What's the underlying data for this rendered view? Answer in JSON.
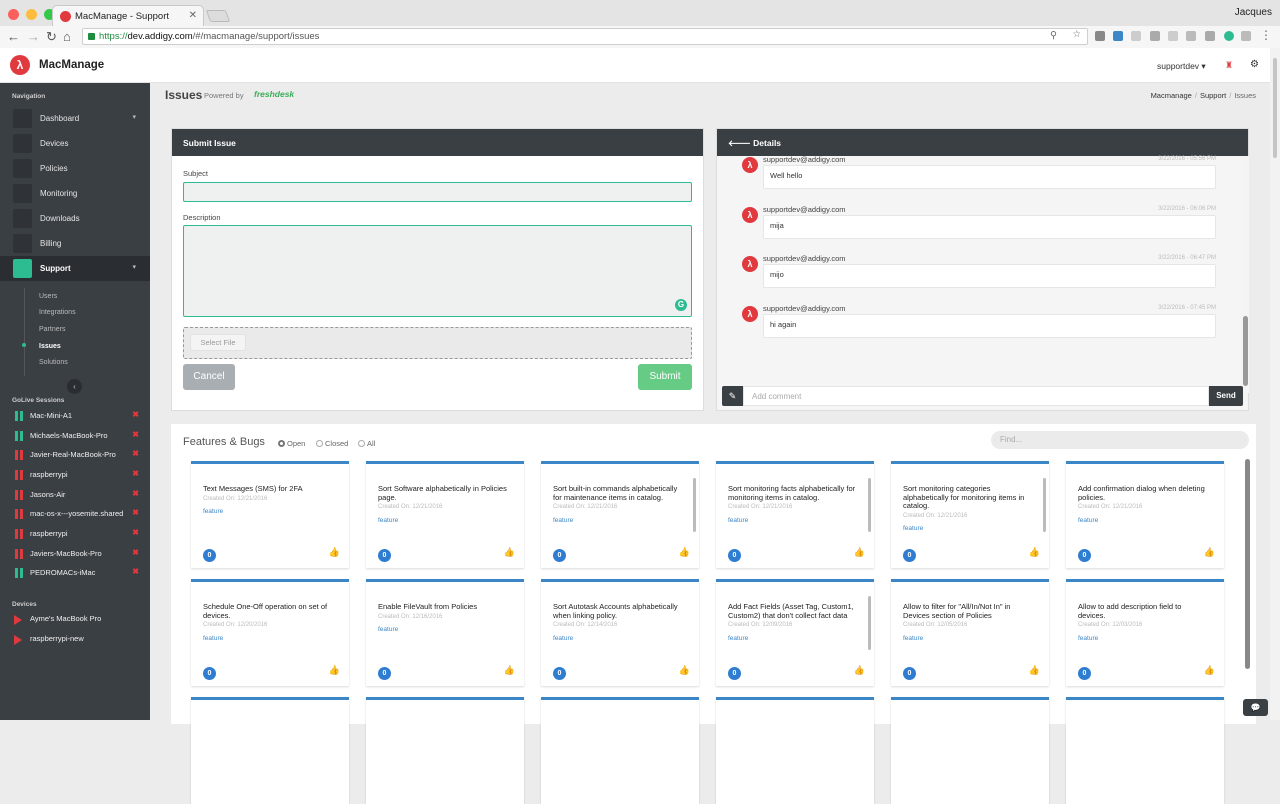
{
  "browser": {
    "tab_title": "MacManage - Support",
    "user": "Jacques",
    "url_scheme": "https://",
    "url_host": "dev.addigy.com",
    "url_path": "/#/macmanage/support/issues"
  },
  "app": {
    "logo_letter": "λ",
    "brand": "MacManage",
    "account": "supportdev ▾"
  },
  "sidebar": {
    "nav_heading": "Navigation",
    "items": [
      {
        "label": "Dashboard",
        "caret": "▾"
      },
      {
        "label": "Devices"
      },
      {
        "label": "Policies"
      },
      {
        "label": "Monitoring"
      },
      {
        "label": "Downloads"
      },
      {
        "label": "Billing"
      },
      {
        "label": "Support",
        "caret": "▾"
      }
    ],
    "sub_items": [
      "Users",
      "Integrations",
      "Partners",
      "Issues",
      "Solutions"
    ],
    "collapse_glyph": "‹",
    "golive_heading": "GoLive Sessions",
    "sessions": [
      {
        "name": "Mac-Mini-A1",
        "status": "online"
      },
      {
        "name": "Michaels-MacBook-Pro",
        "status": "online"
      },
      {
        "name": "Javier-Real-MacBook-Pro",
        "status": "offline"
      },
      {
        "name": "raspberrypi",
        "status": "offline"
      },
      {
        "name": "Jasons-Air",
        "status": "offline"
      },
      {
        "name": "mac-os-x---yosemite.shared",
        "status": "offline"
      },
      {
        "name": "raspberrypi",
        "status": "offline"
      },
      {
        "name": "Javiers-MacBook-Pro",
        "status": "offline"
      },
      {
        "name": "PEDROMACs-iMac",
        "status": "online"
      }
    ],
    "session_close": "✖",
    "devices_heading": "Devices",
    "devices": [
      "Ayme's MacBook Pro",
      "raspberrypi-new"
    ]
  },
  "page": {
    "title": "Issues",
    "powered_by": "Powered by",
    "freshdesk": "freshdesk",
    "breadcrumb": [
      "Macmanage",
      "Support",
      "Issues"
    ]
  },
  "submit": {
    "header": "Submit Issue",
    "subject_label": "Subject",
    "description_label": "Description",
    "select_file": "Select File",
    "cancel": "Cancel",
    "submit": "Submit"
  },
  "details": {
    "header": "🡐 Details",
    "messages": [
      {
        "from": "supportdev@addigy.com",
        "time": "3/22/2016 - 05:56 PM",
        "body": "Well hello"
      },
      {
        "from": "supportdev@addigy.com",
        "time": "3/22/2016 - 06:06 PM",
        "body": "mija"
      },
      {
        "from": "supportdev@addigy.com",
        "time": "3/22/2016 - 06:47 PM",
        "body": "mijo"
      },
      {
        "from": "supportdev@addigy.com",
        "time": "3/22/2016 - 07:45 PM",
        "body": "hi again"
      }
    ],
    "comment_placeholder": "Add comment",
    "send": "Send"
  },
  "features": {
    "title": "Features & Bugs",
    "filters": [
      "Open",
      "Closed",
      "All"
    ],
    "selected_filter": "Open",
    "find_placeholder": "Find...",
    "cards": [
      {
        "title": "Text Messages (SMS) for 2FA",
        "date": "Created On: 12/21/2016",
        "tag": "feature",
        "votes": "0"
      },
      {
        "title": "Sort Software alphabetically in Policies page.",
        "date": "Created On: 12/21/2016",
        "tag": "feature",
        "votes": "0"
      },
      {
        "title": "Sort built-in commands alphabetically for maintenance items in catalog.",
        "date": "Created On: 12/21/2016",
        "tag": "feature",
        "votes": "0"
      },
      {
        "title": "Sort monitoring facts alphabetically for monitoring items in catalog.",
        "date": "Created On: 12/21/2016",
        "tag": "feature",
        "votes": "0"
      },
      {
        "title": "Sort monitoring categories alphabetically for monitoring items in catalog.",
        "date": "Created On: 12/21/2016",
        "tag": "feature",
        "votes": "0"
      },
      {
        "title": "Add confirmation dialog when deleting policies.",
        "date": "Created On: 12/21/2016",
        "tag": "feature",
        "votes": "0"
      },
      {
        "title": "Schedule One-Off operation on set of devices.",
        "date": "Created On: 12/20/2016",
        "tag": "feature",
        "votes": "0"
      },
      {
        "title": "Enable FileVault from Policies",
        "date": "Created On: 12/16/2016",
        "tag": "feature",
        "votes": "0"
      },
      {
        "title": "Sort Autotask Accounts alphabetically when linking policy.",
        "date": "Created On: 12/14/2016",
        "tag": "feature",
        "votes": "0"
      },
      {
        "title": "Add Fact Fields (Asset Tag, Custom1, Custom2) that don't collect fact data",
        "date": "Created On: 12/09/2016",
        "tag": "feature",
        "votes": "0"
      },
      {
        "title": "Allow to filter for \"All/In/Not In\" in Devices section of Policies",
        "date": "Created On: 12/05/2016",
        "tag": "feature",
        "votes": "0"
      },
      {
        "title": "Allow to add description field to devices.",
        "date": "Created On: 12/03/2016",
        "tag": "feature",
        "votes": "0"
      }
    ]
  },
  "colors": {
    "accent": "#2dbc91",
    "brand_red": "#e0393e",
    "sidebar": "#3a3f44",
    "card_blue": "#3b86c7"
  }
}
